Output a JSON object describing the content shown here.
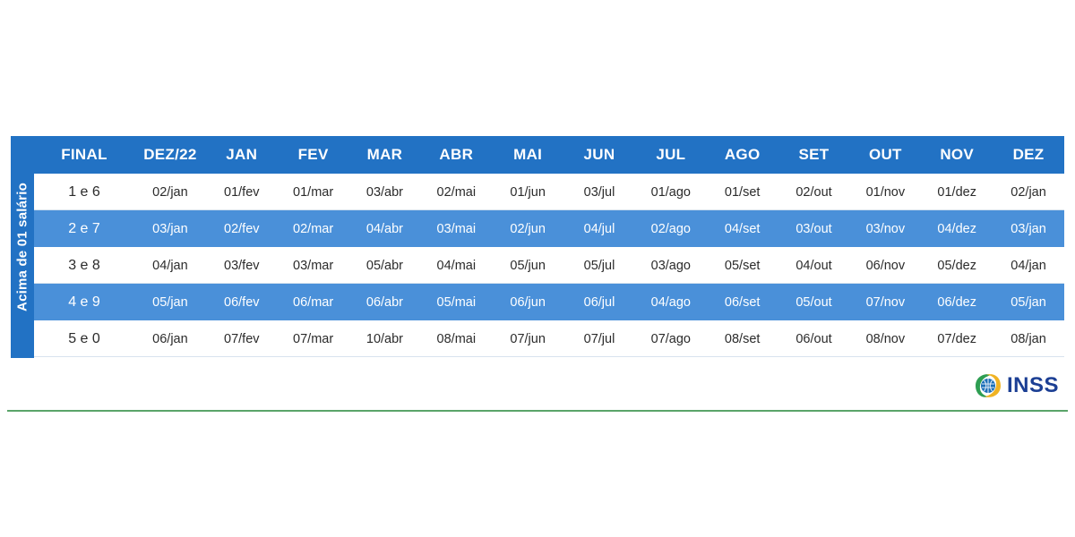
{
  "document": {
    "side_label": "Acima de 01 salário",
    "logo": {
      "text": "INSS",
      "mark_icon": "inss-globe-icon",
      "colors": {
        "green": "#2e9e52",
        "yellow": "#f0b323",
        "globe_blue": "#1c6fb8",
        "wordmark_blue": "#1c3f94"
      }
    },
    "rule_color": "#5aa469",
    "theme": {
      "header_blue": "#2272c4",
      "stripe_blue": "#4a90d9",
      "row_white": "#ffffff",
      "text_dark": "#2b2b2b",
      "text_light": "#ffffff"
    }
  },
  "table": {
    "columns": [
      "FINAL",
      "DEZ/22",
      "JAN",
      "FEV",
      "MAR",
      "ABR",
      "MAI",
      "JUN",
      "JUL",
      "AGO",
      "SET",
      "OUT",
      "NOV",
      "DEZ"
    ],
    "rows": [
      {
        "final": "1 e 6",
        "cells": [
          "02/jan",
          "01/fev",
          "01/mar",
          "03/abr",
          "02/mai",
          "01/jun",
          "03/jul",
          "01/ago",
          "01/set",
          "02/out",
          "01/nov",
          "01/dez",
          "02/jan"
        ]
      },
      {
        "final": "2 e 7",
        "cells": [
          "03/jan",
          "02/fev",
          "02/mar",
          "04/abr",
          "03/mai",
          "02/jun",
          "04/jul",
          "02/ago",
          "04/set",
          "03/out",
          "03/nov",
          "04/dez",
          "03/jan"
        ]
      },
      {
        "final": "3 e 8",
        "cells": [
          "04/jan",
          "03/fev",
          "03/mar",
          "05/abr",
          "04/mai",
          "05/jun",
          "05/jul",
          "03/ago",
          "05/set",
          "04/out",
          "06/nov",
          "05/dez",
          "04/jan"
        ]
      },
      {
        "final": "4 e 9",
        "cells": [
          "05/jan",
          "06/fev",
          "06/mar",
          "06/abr",
          "05/mai",
          "06/jun",
          "06/jul",
          "04/ago",
          "06/set",
          "05/out",
          "07/nov",
          "06/dez",
          "05/jan"
        ]
      },
      {
        "final": "5 e 0",
        "cells": [
          "06/jan",
          "07/fev",
          "07/mar",
          "10/abr",
          "08/mai",
          "07/jun",
          "07/jul",
          "07/ago",
          "08/set",
          "06/out",
          "08/nov",
          "07/dez",
          "08/jan"
        ]
      }
    ]
  }
}
